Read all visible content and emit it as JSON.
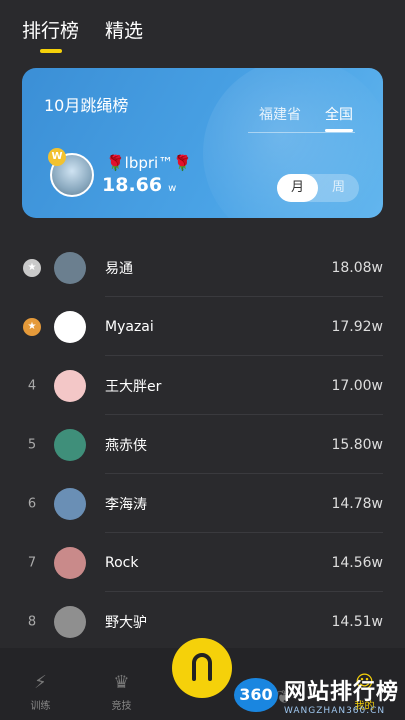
{
  "top_tabs": [
    {
      "label": "排行榜",
      "active": true
    },
    {
      "label": "精选",
      "active": false
    }
  ],
  "hero": {
    "title": "10月跳绳榜",
    "region_tabs": [
      {
        "label": "福建省",
        "active": false
      },
      {
        "label": "全国",
        "active": true
      }
    ],
    "me": {
      "name": "🌹lbpri™🌹",
      "score": "18.66",
      "unit": "w",
      "crown": "W"
    },
    "period": [
      {
        "label": "月",
        "active": true
      },
      {
        "label": "周",
        "active": false
      }
    ]
  },
  "ranking": [
    {
      "rank": "",
      "medal": "silver",
      "name": "易通",
      "score": "18.08w",
      "avatar_color": "#6b7f8f"
    },
    {
      "rank": "",
      "medal": "bronze",
      "name": "Myazai",
      "score": "17.92w",
      "avatar_color": "#ffffff"
    },
    {
      "rank": "4",
      "medal": "",
      "name": "王大胖er",
      "score": "17.00w",
      "avatar_color": "#f3c7c7"
    },
    {
      "rank": "5",
      "medal": "",
      "name": "燕赤侠",
      "score": "15.80w",
      "avatar_color": "#3f8f7a"
    },
    {
      "rank": "6",
      "medal": "",
      "name": "李海涛",
      "score": "14.78w",
      "avatar_color": "#6a8fb5"
    },
    {
      "rank": "7",
      "medal": "",
      "name": "Rock",
      "score": "14.56w",
      "avatar_color": "#c98a8a"
    },
    {
      "rank": "8",
      "medal": "",
      "name": "野大驴",
      "score": "14.51w",
      "avatar_color": "#8f8f8f"
    }
  ],
  "medal_colors": {
    "silver": "#c9c9c9",
    "bronze": "#e59a3a"
  },
  "bottom_nav": [
    {
      "label": "训练",
      "icon": "bolt-icon"
    },
    {
      "label": "竞技",
      "icon": "crown-icon"
    },
    {
      "label": "",
      "icon": "rope-icon"
    },
    {
      "label": "",
      "icon": "leaf-icon"
    },
    {
      "label": "我的",
      "icon": "profile-icon"
    }
  ],
  "watermark": {
    "logo": "360",
    "main": "网站排行榜",
    "sub": "WANGZHAN360.CN"
  }
}
